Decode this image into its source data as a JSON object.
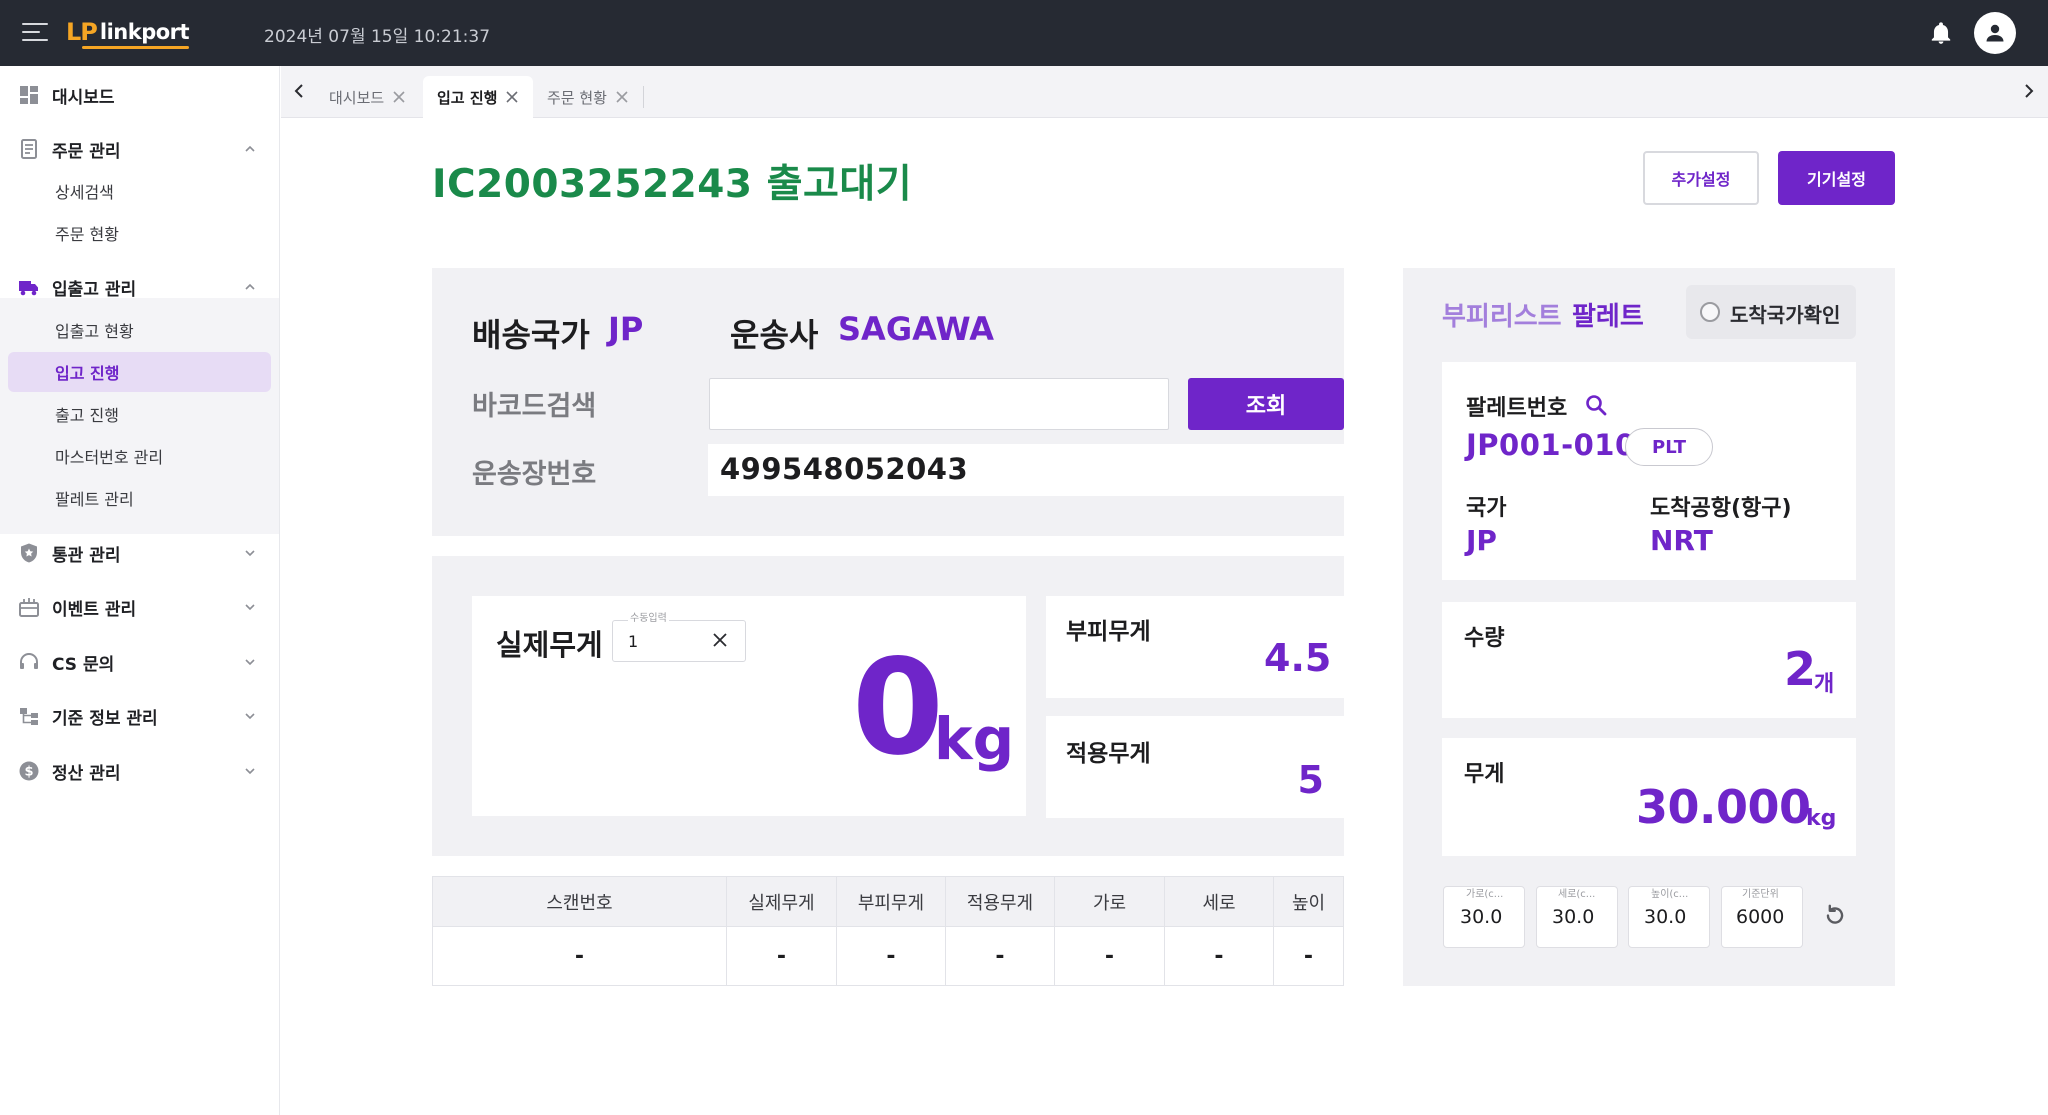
{
  "app": {
    "logo_mark": "LP",
    "logo_text": "linkport",
    "datetime": "2024년 07월 15일 10:21:37"
  },
  "sidebar": {
    "items": [
      {
        "label": "대시보드",
        "icon": "dashboard-icon"
      },
      {
        "label": "주문 관리",
        "icon": "document-icon"
      },
      {
        "label": "입출고 관리",
        "icon": "truck-icon"
      },
      {
        "label": "통관 관리",
        "icon": "shield-icon"
      },
      {
        "label": "이벤트 관리",
        "icon": "gift-icon"
      },
      {
        "label": "CS 문의",
        "icon": "headset-icon"
      },
      {
        "label": "기준 정보 관리",
        "icon": "hierarchy-icon"
      },
      {
        "label": "정산 관리",
        "icon": "dollar-icon"
      }
    ],
    "order_sub": [
      "상세검색",
      "주문 현황"
    ],
    "io_sub": [
      "입출고 현황",
      "입고 진행",
      "출고 진행",
      "마스터번호 관리",
      "팔레트 관리"
    ]
  },
  "tabs": [
    {
      "label": "대시보드"
    },
    {
      "label": "입고 진행"
    },
    {
      "label": "주문 현황"
    }
  ],
  "page": {
    "title": "IC2003252243 출고대기",
    "extra_settings": "추가설정",
    "device_settings": "기기설정"
  },
  "shipping": {
    "country_label": "배송국가",
    "country_value": "JP",
    "carrier_label": "운송사",
    "carrier_value": "SAGAWA",
    "barcode_label": "바코드검색",
    "barcode_value": "",
    "search_button": "조회",
    "waybill_label": "운송장번호",
    "waybill_value": "499548052043"
  },
  "weight": {
    "actual_label": "실제무게",
    "manual_caption": "수동입력",
    "manual_value": "1",
    "actual_value": "0",
    "actual_unit": "kg",
    "volumetric_label": "부피무게",
    "volumetric_value": "4.5",
    "applied_label": "적용무게",
    "applied_value": "5"
  },
  "table": {
    "headers": [
      "스캔번호",
      "실제무게",
      "부피무게",
      "적용무게",
      "가로",
      "세로",
      "높이"
    ],
    "rows": [
      [
        "-",
        "-",
        "-",
        "-",
        "-",
        "-",
        "-"
      ]
    ]
  },
  "pallet": {
    "title_a": "부피리스트",
    "title_b": "팔레트",
    "arrive_check": "도착국가확인",
    "no_label": "팔레트번호",
    "no_value": "JP001-010",
    "badge": "PLT",
    "country_label": "국가",
    "country_value": "JP",
    "airport_label": "도착공항(항구)",
    "airport_value": "NRT",
    "qty_label": "수량",
    "qty_value": "2",
    "qty_unit": "개",
    "weight_label": "무게",
    "weight_value": "30.000",
    "weight_unit": "kg",
    "dims": [
      {
        "caption": "가로(c...",
        "value": "30.0"
      },
      {
        "caption": "세로(c...",
        "value": "30.0"
      },
      {
        "caption": "높이(c...",
        "value": "30.0"
      },
      {
        "caption": "기준단위",
        "value": "6000"
      }
    ]
  },
  "colors": {
    "accent": "#6f25c9",
    "title_green": "#1a8a4a",
    "topbar": "#262a33",
    "logo_orange": "#f5a524"
  }
}
